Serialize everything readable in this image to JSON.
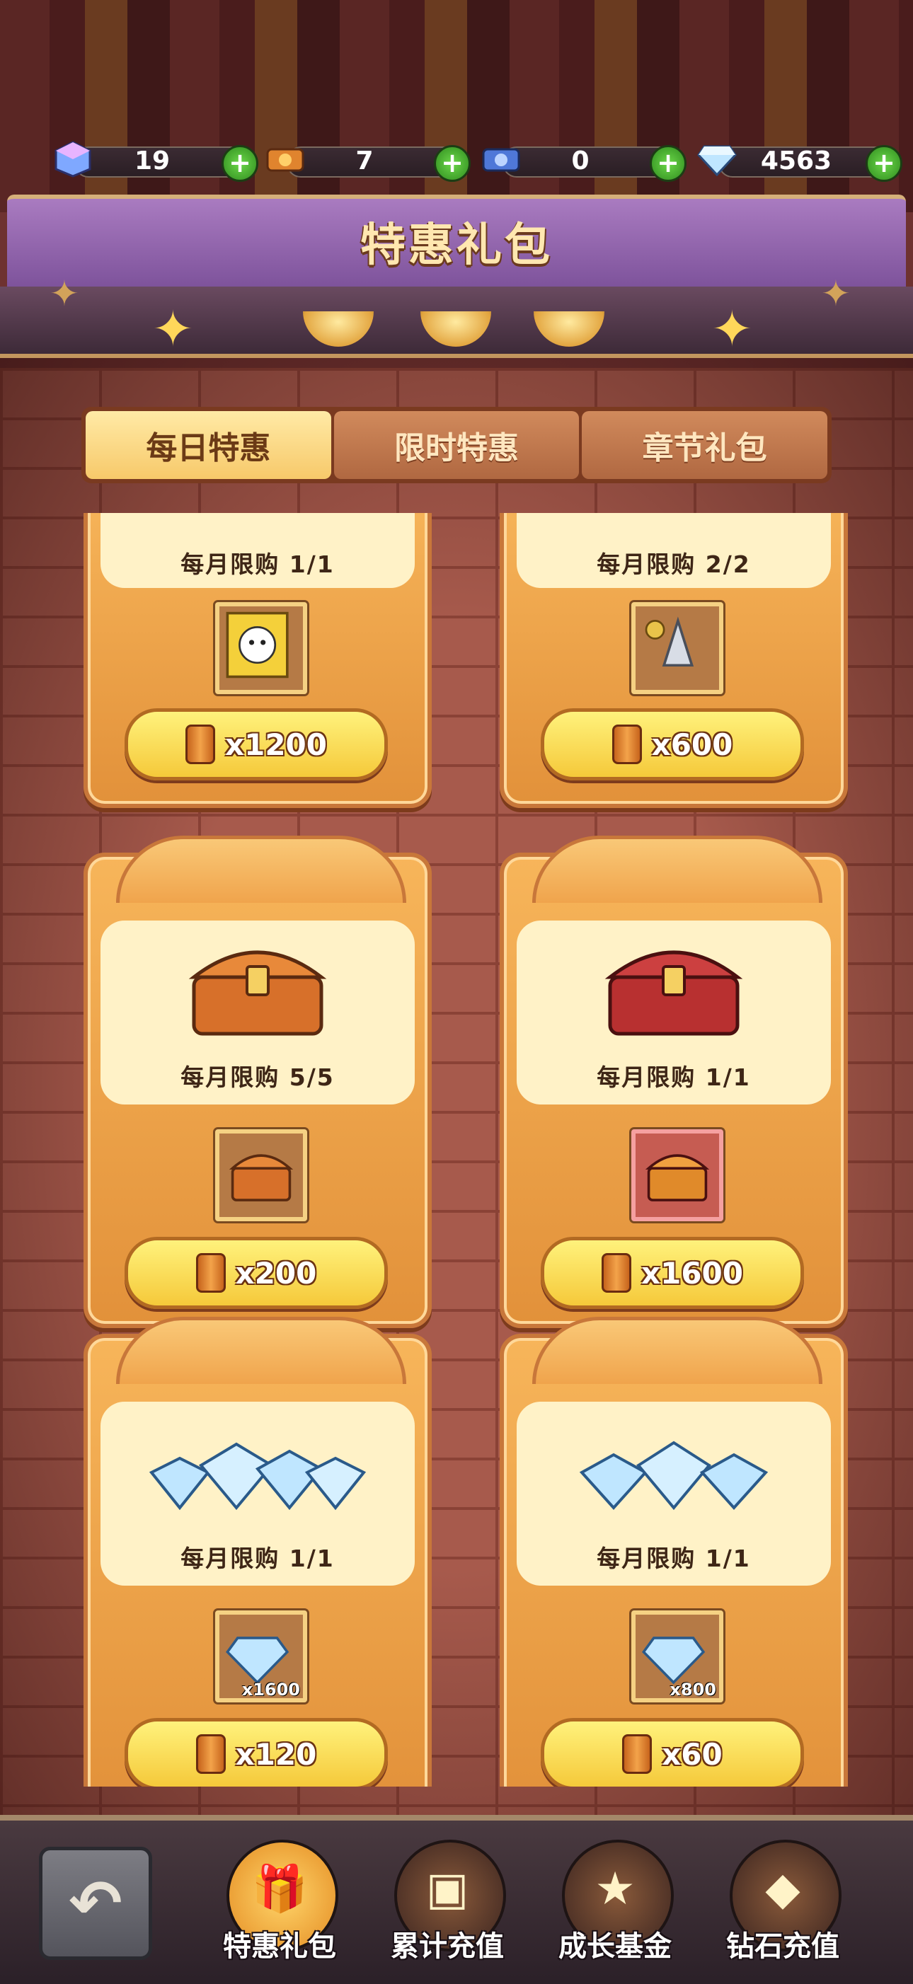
{
  "currencies": [
    {
      "icon": "cube-gem-icon",
      "value": "19"
    },
    {
      "icon": "ticket-icon",
      "value": "7"
    },
    {
      "icon": "blue-ticket-icon",
      "value": "0"
    },
    {
      "icon": "diamond-icon",
      "value": "4563"
    }
  ],
  "header": {
    "title": "特惠礼包"
  },
  "tabs": [
    {
      "label": "每日特惠",
      "active": true
    },
    {
      "label": "限时特惠",
      "active": false
    },
    {
      "label": "章节礼包",
      "active": false
    }
  ],
  "cards": [
    {
      "item": "hero-card-icon",
      "limit": "每月限购 1/1",
      "price": "x1200",
      "slot_qty": ""
    },
    {
      "item": "drill-part-icon",
      "limit": "每月限购 2/2",
      "price": "x600",
      "slot_qty": ""
    },
    {
      "item": "orange-chest-icon",
      "limit": "每月限购 5/5",
      "price": "x200",
      "slot_qty": ""
    },
    {
      "item": "red-chest-icon",
      "limit": "每月限购 1/1",
      "price": "x1600",
      "slot_qty": ""
    },
    {
      "item": "diamond-pile-icon",
      "limit": "每月限购 1/1",
      "price": "x120",
      "slot_qty": "x1600"
    },
    {
      "item": "diamond-pile-icon",
      "limit": "每月限购 1/1",
      "price": "x60",
      "slot_qty": "x800"
    }
  ],
  "bottom_nav": [
    {
      "label": "特惠礼包",
      "icon": "gift-box-icon",
      "active": true
    },
    {
      "label": "累计充值",
      "icon": "treasure-chest-icon",
      "active": false
    },
    {
      "label": "成长基金",
      "icon": "star-badge-icon",
      "active": false
    },
    {
      "label": "钻石充值",
      "icon": "diamond-cart-icon",
      "active": false
    }
  ],
  "colors": {
    "accent": "#f5c93a",
    "tab_active": "#f7c96a",
    "banner": "#7c519a"
  }
}
